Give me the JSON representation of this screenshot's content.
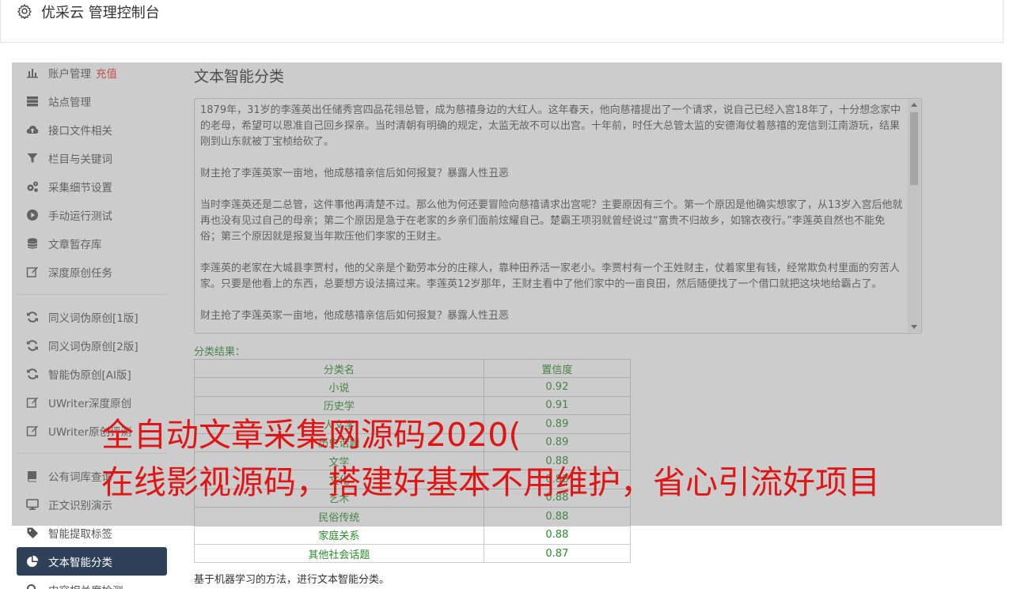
{
  "header": {
    "title": "优采云 管理控制台",
    "icon": "gear-icon"
  },
  "sidebar": {
    "account": {
      "label": "账户管理",
      "recharge": "充值"
    },
    "group1": [
      {
        "label": "站点管理",
        "icon": "server-icon"
      },
      {
        "label": "接口文件相关",
        "icon": "cloud-upload-icon"
      },
      {
        "label": "栏目与关键词",
        "icon": "filter-icon"
      },
      {
        "label": "采集细节设置",
        "icon": "gears-icon"
      },
      {
        "label": "手动运行测试",
        "icon": "play-circle-icon"
      },
      {
        "label": "文章暂存库",
        "icon": "database-icon"
      },
      {
        "label": "深度原创任务",
        "icon": "edit-icon"
      }
    ],
    "group2": [
      {
        "label": "同义词伪原创[1版]",
        "icon": "refresh-icon"
      },
      {
        "label": "同义词伪原创[2版]",
        "icon": "refresh-icon"
      },
      {
        "label": "智能伪原创[AI版]",
        "icon": "refresh-icon"
      },
      {
        "label": "UWriter深度原创",
        "icon": "edit-icon"
      },
      {
        "label": "UWriter原创评测",
        "icon": "edit-icon"
      }
    ],
    "group3": [
      {
        "label": "公有词库查询",
        "icon": "book-icon"
      },
      {
        "label": "正文识别演示",
        "icon": "desktop-icon"
      },
      {
        "label": "智能提取标签",
        "icon": "tag-icon"
      },
      {
        "label": "文本智能分类",
        "icon": "pie-chart-icon",
        "active": true
      },
      {
        "label": "内容相关度检测",
        "icon": "search-icon"
      }
    ]
  },
  "main": {
    "title": "文本智能分类",
    "text": "1879年，31岁的李莲英出任储秀宫四品花翎总管，成为慈禧身边的大红人。这年春天，他向慈禧提出了一个请求，说自己已经入宫18年了，十分想念家中的老母，希望可以恩准自己回乡探亲。当时清朝有明确的规定，太监无故不可以出宫。十年前，时任大总管太监的安德海仗着慈禧的宠信到江南游玩，结果刚到山东就被丁宝桢给砍了。\n\n财主抢了李莲英家一亩地，他成慈禧亲信后如何报复？暴露人性丑恶\n\n当时李莲英还是二总管，这件事他再清楚不过。那么他为何还要冒险向慈禧请求出宫呢？主要原因有三个。第一个原因是他确实想家了，从13岁入宫后他就再也没有见过自己的母亲；第二个原因是急于在老家的乡亲们面前炫耀自己。楚霸王项羽就曾经说过“富贵不归故乡，如锦衣夜行。”李莲英自然也不能免俗；第三个原因就是报复当年欺压他们李家的王财主。\n\n李莲英的老家在大城县李贾村，他的父亲是个勤劳本分的庄稼人，靠种田养活一家老小。李贾村有一个王姓财主，仗着家里有钱，经常欺负村里面的穷苦人家。只要是他看上的东西，总要想方设法搞过来。李莲英12岁那年，王财主看中了他们家中的一亩良田，然后随便找了一个借口就把这块地给霸占了。\n\n财主抢了李莲英家一亩地，他成慈禧亲信后如何报复？暴露人性丑恶",
    "result_label": "分类结果：",
    "table": {
      "headers": [
        "分类名",
        "置信度"
      ],
      "rows": [
        [
          "小说",
          "0.92"
        ],
        [
          "历史学",
          "0.91"
        ],
        [
          "人文学",
          "0.89"
        ],
        [
          "历史话题",
          "0.89"
        ],
        [
          "文学",
          "0.88"
        ],
        [
          "文化",
          "0.88"
        ],
        [
          "艺术",
          "0.88"
        ],
        [
          "民俗传统",
          "0.88"
        ],
        [
          "家庭关系",
          "0.88"
        ],
        [
          "其他社会话题",
          "0.87"
        ]
      ]
    },
    "description": "基于机器学习的方法，进行文本智能分类。"
  },
  "watermark": {
    "line1": "全自动文章采集网源码2020(",
    "line2": "在线影视源码，搭建好基本不用维护，省心引流好项目"
  },
  "colors": {
    "sidebar_active": "#2f4158",
    "result_green": "#2a8a2a",
    "recharge_red": "#e33333",
    "watermark_red": "#e01515"
  }
}
